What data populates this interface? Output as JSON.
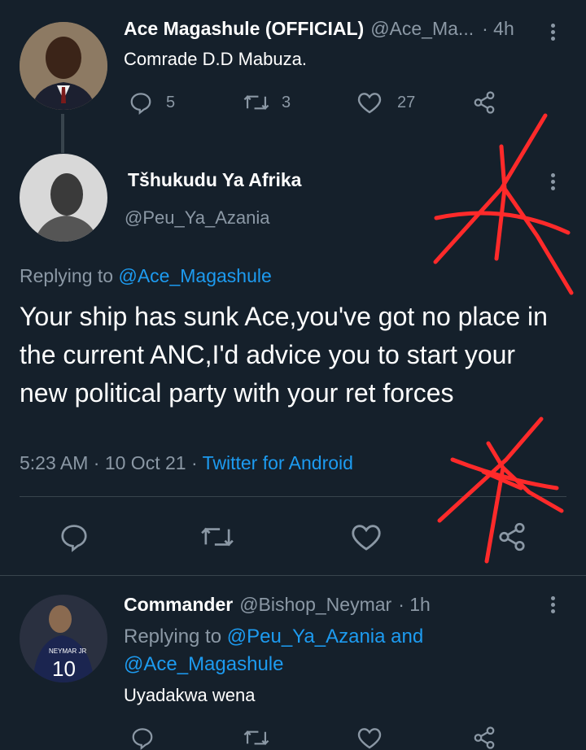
{
  "colors": {
    "background": "#15202b",
    "text": "#ffffff",
    "muted": "#8b98a5",
    "link": "#1d9bf0",
    "divider": "#38444d",
    "scribble": "#ff2a2a"
  },
  "tweet1": {
    "display_name": "Ace Magashule (OFFICIAL)",
    "handle": "@Ace_Ma...",
    "time": "· 4h",
    "text": "Comrade D.D Mabuza.",
    "replies": "5",
    "retweets": "3",
    "likes": "27"
  },
  "tweet2": {
    "display_name": "Tšhukudu Ya Afrika",
    "handle": "@Peu_Ya_Azania",
    "replying_prefix": "Replying to",
    "replying_to": "@Ace_Magashule",
    "text": "Your ship has sunk Ace,you've got no place in the current ANC,I'd advice you to start your new political party with your ret forces",
    "timestamp": "5:23 AM · 10 Oct 21 ·",
    "source": "Twitter for Android"
  },
  "tweet3": {
    "display_name": "Commander",
    "handle": "@Bishop_Neymar",
    "time": "· 1h",
    "replying_prefix": "Replying to",
    "replying_to_1": "@Peu_Ya_Azania and",
    "replying_to_2": "@Ace_Magashule",
    "text": "Uyadakwa wena",
    "avatar_jersey_name": "NEYMAR JR",
    "avatar_jersey_number": "10"
  },
  "icons": {
    "reply": "reply-icon",
    "retweet": "retweet-icon",
    "like": "heart-icon",
    "share": "share-icon",
    "more": "more-vertical-icon"
  }
}
